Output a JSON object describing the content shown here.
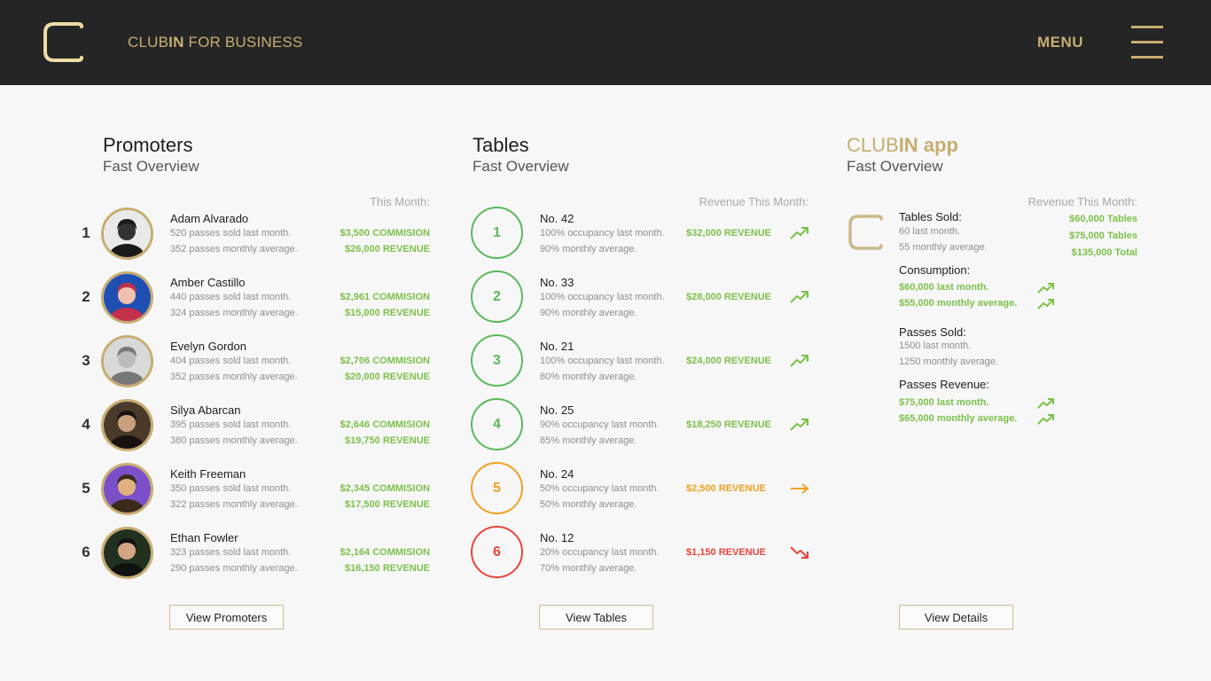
{
  "header": {
    "brand_prefix": "CLUB",
    "brand_bold": "IN",
    "brand_suffix": " FOR BUSINESS",
    "menu_label": "MENU",
    "accent_color": "#c7ad72",
    "bar_color": "#252525"
  },
  "promoters": {
    "title": "Promoters",
    "subtitle": "Fast Overview",
    "column_header": "This Month:",
    "button": "View Promoters",
    "items": [
      {
        "rank": "1",
        "name": "Adam Alvarado",
        "line1": "520 passes sold last month.",
        "line2": "352 passes monthly average.",
        "commission": "$3,500 COMMISION",
        "revenue": "$26,000 REVENUE"
      },
      {
        "rank": "2",
        "name": "Amber Castillo",
        "line1": "440 passes sold last month.",
        "line2": "324 passes monthly average.",
        "commission": "$2,961 COMMISION",
        "revenue": "$15,000 REVENUE"
      },
      {
        "rank": "3",
        "name": "Evelyn Gordon",
        "line1": "404 passes sold last month.",
        "line2": "352 passes monthly average.",
        "commission": "$2,706 COMMISION",
        "revenue": "$20,000 REVENUE"
      },
      {
        "rank": "4",
        "name": "Silya Abarcan",
        "line1": "395 passes sold last month.",
        "line2": "380 passes monthly average.",
        "commission": "$2,646 COMMISION",
        "revenue": "$19,750 REVENUE"
      },
      {
        "rank": "5",
        "name": "Keith Freeman",
        "line1": "350 passes sold last month.",
        "line2": "322 passes monthly average.",
        "commission": "$2,345 COMMISION",
        "revenue": "$17,500 REVENUE"
      },
      {
        "rank": "6",
        "name": "Ethan Fowler",
        "line1": "323 passes sold last month.",
        "line2": "290 passes monthly average.",
        "commission": "$2,164 COMMISION",
        "revenue": "$16,150 REVENUE"
      }
    ]
  },
  "tables": {
    "title": "Tables",
    "subtitle": "Fast Overview",
    "column_header": "Revenue This Month:",
    "button": "View Tables",
    "items": [
      {
        "rank": "1",
        "name": "No. 42",
        "line1": "100% occupancy last month.",
        "line2": "90% monthly average.",
        "revenue": "$32,000 REVENUE",
        "trend": "up",
        "color": "#5bb85d"
      },
      {
        "rank": "2",
        "name": "No. 33",
        "line1": "100% occupancy last month.",
        "line2": "90% monthly average.",
        "revenue": "$28,000 REVENUE",
        "trend": "up",
        "color": "#5bb85d"
      },
      {
        "rank": "3",
        "name": "No. 21",
        "line1": "100% occupancy last month.",
        "line2": "80% monthly average.",
        "revenue": "$24,000 REVENUE",
        "trend": "up",
        "color": "#5bb85d"
      },
      {
        "rank": "4",
        "name": "No. 25",
        "line1": "90% occupancy last month.",
        "line2": "85% monthly average.",
        "revenue": "$18,250 REVENUE",
        "trend": "up",
        "color": "#5bb85d"
      },
      {
        "rank": "5",
        "name": "No. 24",
        "line1": "50% occupancy last month.",
        "line2": "50% monthly average.",
        "revenue": "$2,500 REVENUE",
        "trend": "flat",
        "color": "#f0a020"
      },
      {
        "rank": "6",
        "name": "No. 12",
        "line1": "20% occupancy last month.",
        "line2": "70% monthly average.",
        "revenue": "$1,150 REVENUE",
        "trend": "down",
        "color": "#e8453c"
      }
    ]
  },
  "app": {
    "title_light": "CLUB",
    "title_bold": "IN app",
    "subtitle": "Fast Overview",
    "column_header": "Revenue This Month:",
    "button": "View Details",
    "tables_sold": {
      "label": "Tables Sold:",
      "line1": "60 last month.",
      "line2": "55 monthly average."
    },
    "revenue": [
      "$60,000 Tables",
      "$75,000 Tables",
      "$135,000 Total"
    ],
    "consumption": {
      "label": "Consumption:",
      "line1": "$60,000 last month.",
      "line2": "$55,000 monthly average."
    },
    "passes_sold": {
      "label": "Passes Sold:",
      "line1": "1500 last month.",
      "line2": "1250 monthly average."
    },
    "passes_revenue": {
      "label": "Passes Revenue:",
      "line1": "$75,000 last month.",
      "line2": "$65,000 monthly average."
    }
  }
}
